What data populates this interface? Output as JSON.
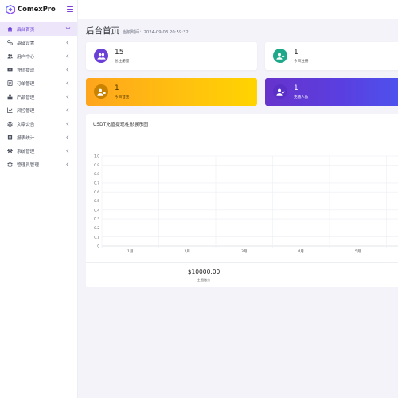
{
  "brand": {
    "name": "ComexPro"
  },
  "sidebar": {
    "items": [
      {
        "label": "后台首页",
        "icon": "home-icon",
        "active": true
      },
      {
        "label": "基础设置",
        "icon": "settings-icon"
      },
      {
        "label": "用户中心",
        "icon": "users-icon"
      },
      {
        "label": "充值提现",
        "icon": "money-icon"
      },
      {
        "label": "订单管理",
        "icon": "orders-icon"
      },
      {
        "label": "产品管理",
        "icon": "products-icon"
      },
      {
        "label": "风控管理",
        "icon": "risk-chart-icon"
      },
      {
        "label": "文章公告",
        "icon": "layers-icon"
      },
      {
        "label": "报表统计",
        "icon": "report-icon"
      },
      {
        "label": "系统管理",
        "icon": "gear-icon"
      },
      {
        "label": "管理员管理",
        "icon": "admins-icon"
      }
    ]
  },
  "header": {
    "title": "后台首页",
    "time": "当前时间：2024-09-03 20:59:32"
  },
  "stats": [
    {
      "value": "15",
      "label": "总注册量",
      "icon": "users-circle-icon",
      "color": "#6a3fd6"
    },
    {
      "value": "1",
      "label": "今日注册",
      "icon": "user-plus-icon",
      "color": "#1ea88a"
    },
    {
      "value": "1",
      "label": "今日首充",
      "icon": "user-money-icon",
      "color": "#c98300"
    },
    {
      "value": "1",
      "label": "充值人数",
      "icon": "user-check-icon",
      "color": "#5a2fc8"
    }
  ],
  "chart": {
    "title": "USDT充值提现柱形展示图"
  },
  "chart_data": {
    "type": "bar",
    "categories": [
      "1月",
      "2月",
      "3月",
      "4月",
      "5月"
    ],
    "series": [],
    "ylim": [
      0,
      1
    ],
    "yticks": [
      "0",
      "0.1",
      "0.2",
      "0.3",
      "0.4",
      "0.5",
      "0.6",
      "0.7",
      "0.8",
      "0.9",
      "1.0"
    ],
    "grid": true
  },
  "summary": {
    "value": "$10000.00",
    "label": "主图账余"
  }
}
